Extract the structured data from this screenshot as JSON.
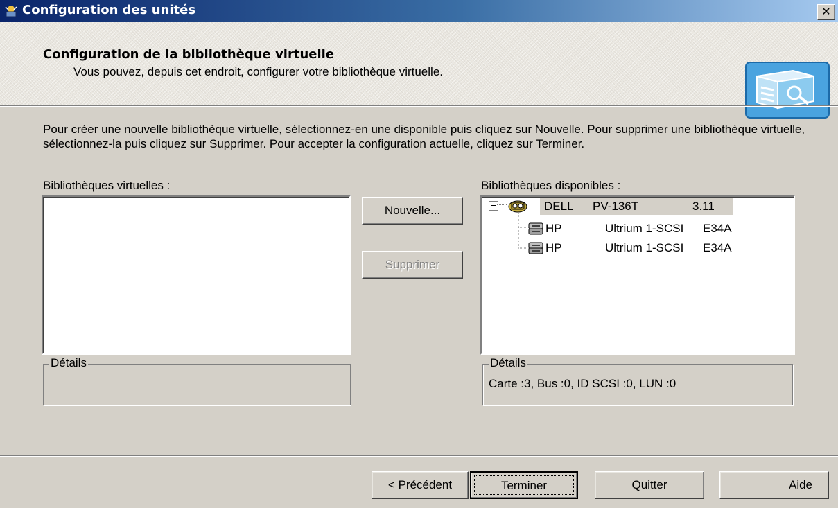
{
  "window": {
    "title": "Configuration des unités",
    "close_label": "✕"
  },
  "header": {
    "title": "Configuration de la bibliothèque virtuelle",
    "subtitle": "Vous pouvez, depuis cet endroit, configurer votre bibliothèque virtuelle."
  },
  "intro": "Pour créer une nouvelle bibliothèque virtuelle, sélectionnez-en une disponible puis cliquez sur Nouvelle. Pour supprimer une bibliothèque virtuelle, sélectionnez-la puis cliquez sur Supprimer. Pour accepter la configuration actuelle, cliquez sur Terminer.",
  "virtual": {
    "label": "Bibliothèques virtuelles :",
    "details_label": "Détails",
    "details_text": ""
  },
  "available": {
    "label": "Bibliothèques disponibles :",
    "root": {
      "vendor": "DELL",
      "model": "PV-136T",
      "rev": "3.11",
      "expanded": true
    },
    "children": [
      {
        "vendor": "HP",
        "model": "Ultrium 1-SCSI",
        "rev": "E34A"
      },
      {
        "vendor": "HP",
        "model": "Ultrium 1-SCSI",
        "rev": "E34A"
      }
    ],
    "details_label": "Détails",
    "details_text": "Carte :3, Bus :0, ID SCSI :0, LUN :0"
  },
  "buttons": {
    "new": "Nouvelle...",
    "delete": "Supprimer",
    "prev": "< Précédent",
    "finish": "Terminer",
    "quit": "Quitter",
    "help": "Aide"
  },
  "icons": {
    "app": "wizard-app-icon",
    "header": "library-config-icon",
    "library": "tape-library-icon",
    "drive": "tape-drive-icon"
  },
  "colors": {
    "titlebar_start": "#0a246a",
    "titlebar_end": "#a6caf0",
    "face": "#d4d0c8",
    "tree_selection": "#d4d0c8"
  }
}
